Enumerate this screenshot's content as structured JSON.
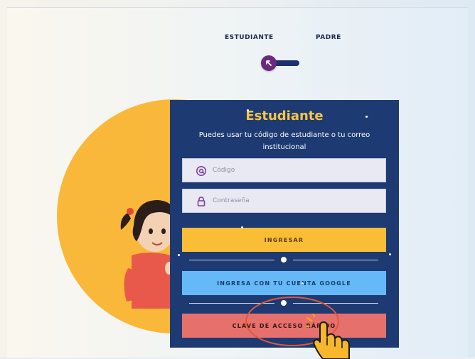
{
  "roles": {
    "student_label": "ESTUDIANTE",
    "parent_label": "PADRE",
    "selected": "ESTUDIANTE"
  },
  "card": {
    "title": "Estudiante",
    "subtitle": "Puedes usar tu código de estudiante o tu correo institucional",
    "code_placeholder": "Código",
    "password_placeholder": "Contraseña",
    "login_button": "INGRESAR",
    "separator_label": "O",
    "google_button": "INGRESA CON TU CUENTA GOOGLE",
    "quick_access_button": "CLAVE DE ACCESO RÁPIDO"
  },
  "colors": {
    "card_bg": "#1d3a73",
    "title": "#f8c645",
    "login_button": "#f9be36",
    "google_button": "#66b9f7",
    "quick_access_button": "#e6706c",
    "accent_circle": "#f9b83a",
    "annotation": "#e2573a"
  },
  "icons": {
    "code_field": "at-icon",
    "password_field": "lock-icon",
    "toggle": "arrow-up-left-icon",
    "annotation_pointer": "pointing-hand-icon"
  }
}
